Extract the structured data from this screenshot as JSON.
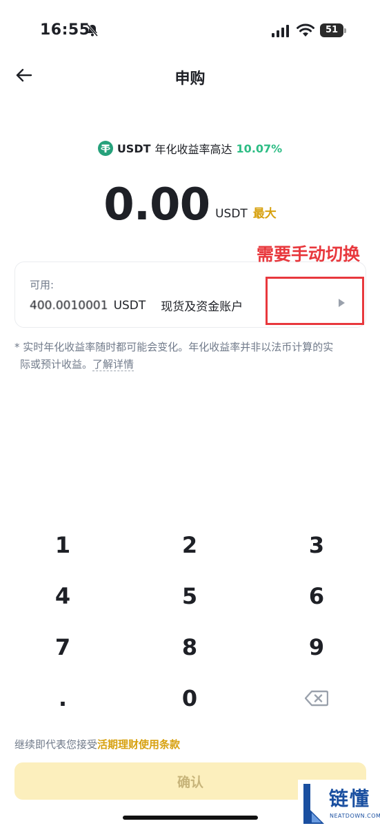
{
  "status_bar": {
    "time": "16:55",
    "battery": "51"
  },
  "header": {
    "title": "申购"
  },
  "apr": {
    "coin": "USDT",
    "text": "年化收益率高达",
    "rate": "10.07%"
  },
  "amount": {
    "value": "0.00",
    "unit": "USDT",
    "max_label": "最大"
  },
  "annotation": {
    "text": "需要手动切换"
  },
  "account": {
    "available_label": "可用:",
    "balance": "400.0010001",
    "unit": "USDT",
    "type": "现货及资金账户"
  },
  "disclaimer": {
    "line1": "* 实时年化收益率随时都可能会变化。年化收益率并非以法币计算的实",
    "line2": "际或预计收益。",
    "learn_more": "了解详情"
  },
  "keypad": {
    "keys": [
      "1",
      "2",
      "3",
      "4",
      "5",
      "6",
      "7",
      "8",
      "9",
      ".",
      "0"
    ]
  },
  "terms": {
    "prefix": "继续即代表您接受",
    "link": "活期理财使用条款"
  },
  "confirm": {
    "label": "确认"
  },
  "watermark": {
    "title": "链懂",
    "subtitle": "NEATDOWN.COM"
  },
  "colors": {
    "accent": "#d7a10f",
    "positive": "#2ebd85",
    "annotation": "#e8383d",
    "confirm_bg": "#fcefbd"
  }
}
